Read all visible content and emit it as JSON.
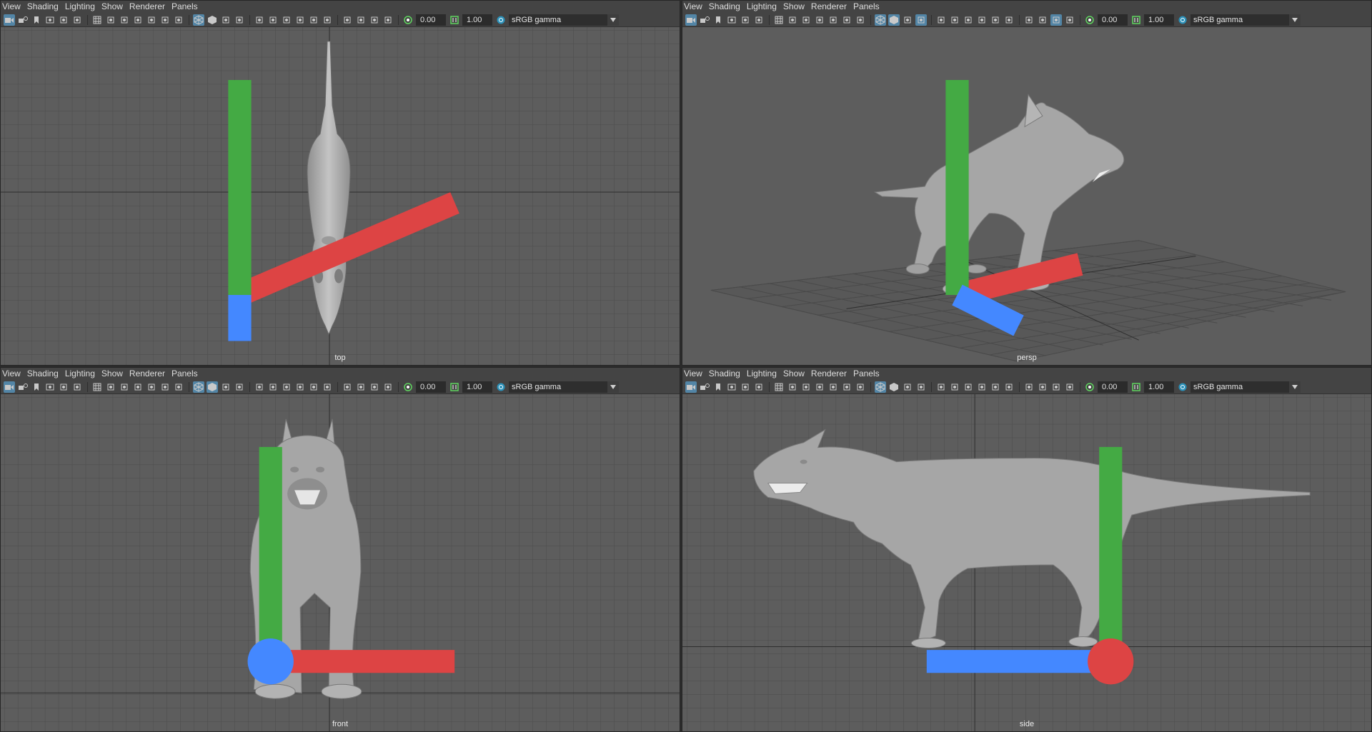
{
  "menu": [
    "View",
    "Shading",
    "Lighting",
    "Show",
    "Renderer",
    "Panels"
  ],
  "viewports": [
    {
      "camera": "top",
      "exposure": "0.00",
      "gamma": "1.00",
      "colorspace": "sRGB gamma"
    },
    {
      "camera": "persp",
      "exposure": "0.00",
      "gamma": "1.00",
      "colorspace": "sRGB gamma"
    },
    {
      "camera": "front",
      "exposure": "0.00",
      "gamma": "1.00",
      "colorspace": "sRGB gamma"
    },
    {
      "camera": "side",
      "exposure": "0.00",
      "gamma": "1.00",
      "colorspace": "sRGB gamma"
    }
  ],
  "colors": {
    "viewport_bg": "#5d5d5d",
    "grid": "#4c4c4c",
    "grid_axis": "#2e2e2e",
    "model": "#a8a8a8",
    "highlight": "#5285a6"
  },
  "toolbar_icons": [
    "camera-icon",
    "camera-attributes-icon",
    "bookmark-icon",
    "image-plane-icon",
    "2d-pan-zoom-icon",
    "grease-pencil-icon",
    "grid-icon",
    "film-gate-icon",
    "resolution-gate-icon",
    "gate-mask-icon",
    "field-chart-icon",
    "safe-action-icon",
    "safe-title-icon",
    "wireframe-icon",
    "smooth-shade-icon",
    "wireframe-on-shaded-icon",
    "textured-icon",
    "use-all-lights-icon",
    "shadows-icon",
    "screen-space-ao-icon",
    "motion-blur-icon",
    "multisample-aa-icon",
    "depth-of-field-icon",
    "isolate-select-icon",
    "xray-icon",
    "xray-joints-icon",
    "xray-components-icon",
    "exposure-icon",
    "gamma-icon",
    "color-management-icon"
  ]
}
